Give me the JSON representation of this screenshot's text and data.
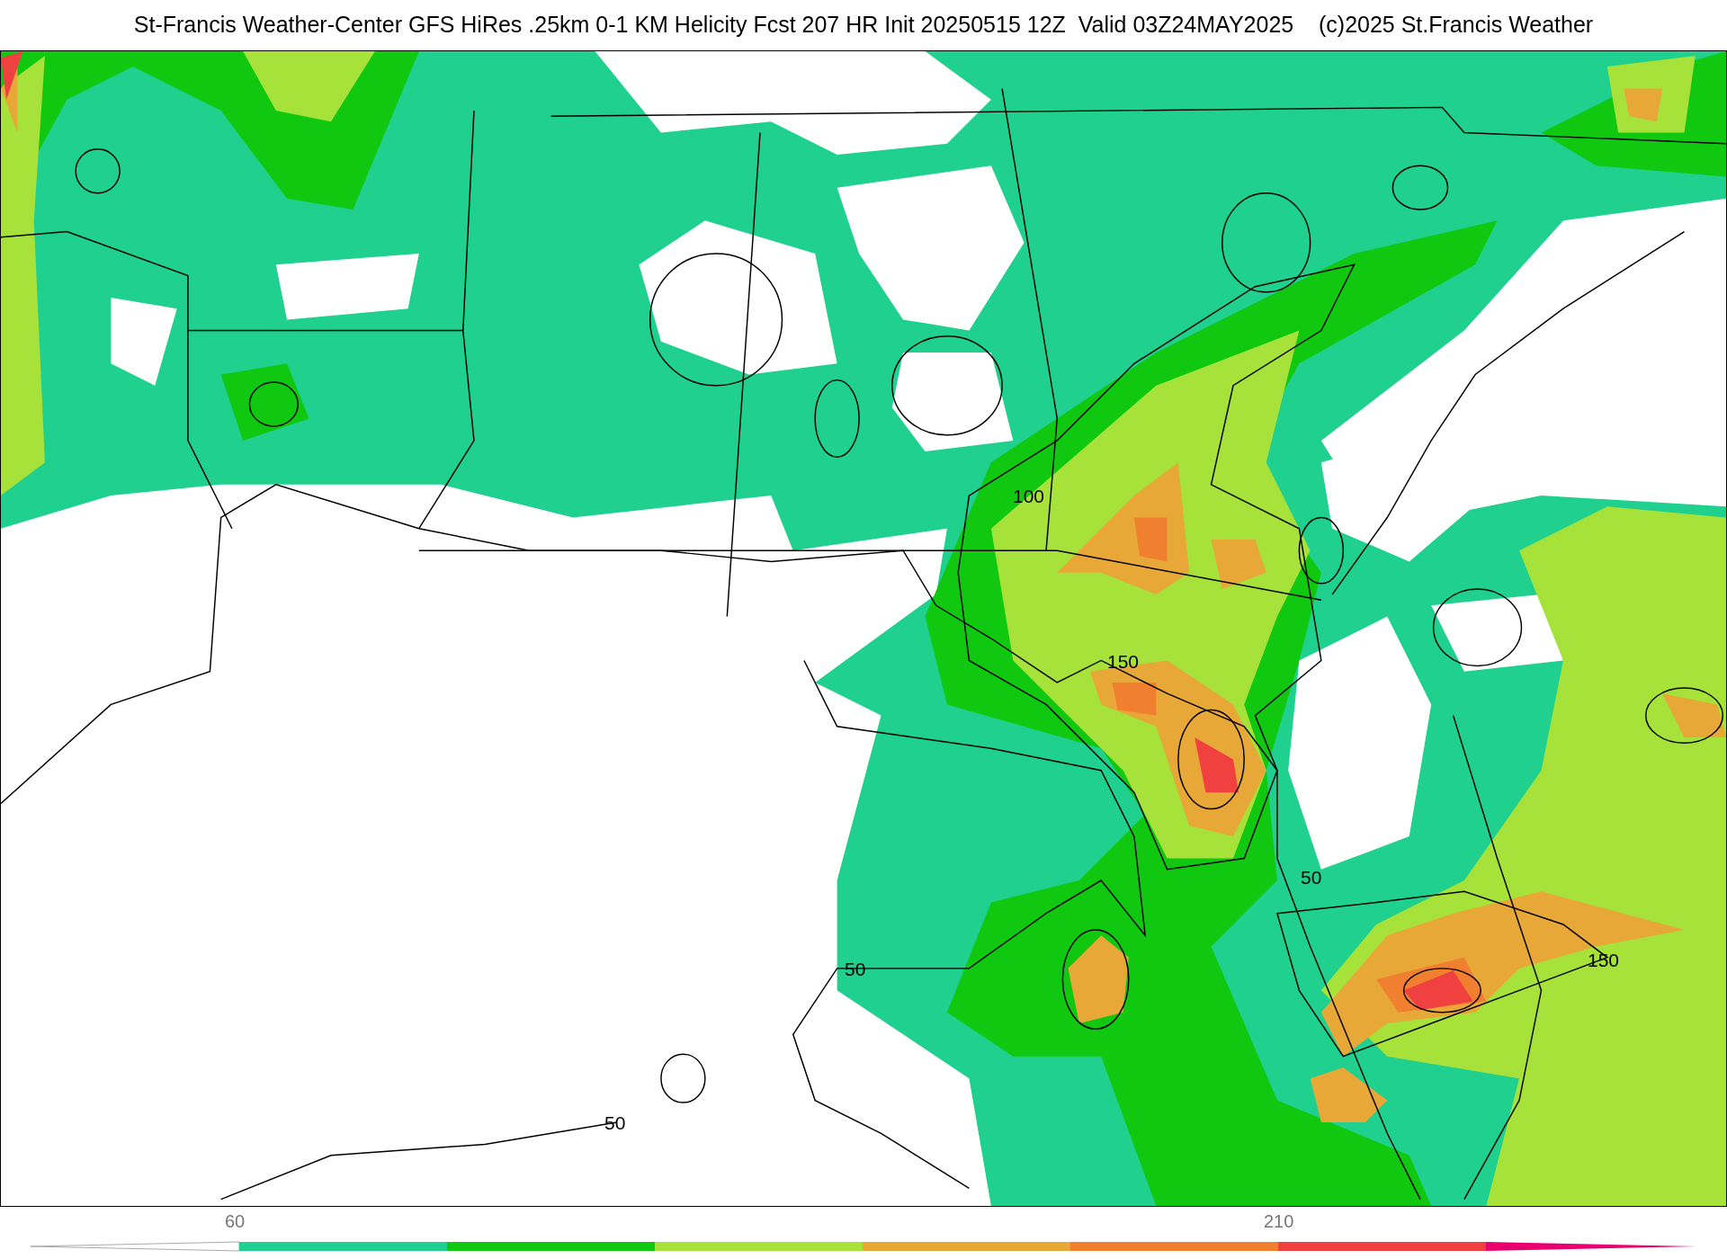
{
  "title": "St-Francis Weather-Center GFS HiRes .25km 0-1 KM Helicity Fcst 207 HR Init 20250515 12Z  Valid 03Z24MAY2025    (c)2025 St.Francis Weather",
  "contour_labels": [
    "100",
    "150",
    "50",
    "150",
    "50",
    "50"
  ],
  "colorbar": {
    "ticks": [
      "60",
      "210"
    ],
    "segments": [
      {
        "color": "#1fd08f"
      },
      {
        "color": "#10c810"
      },
      {
        "color": "#a6e23a"
      },
      {
        "color": "#e8a838"
      },
      {
        "color": "#f08030"
      },
      {
        "color": "#f04040"
      }
    ]
  }
}
